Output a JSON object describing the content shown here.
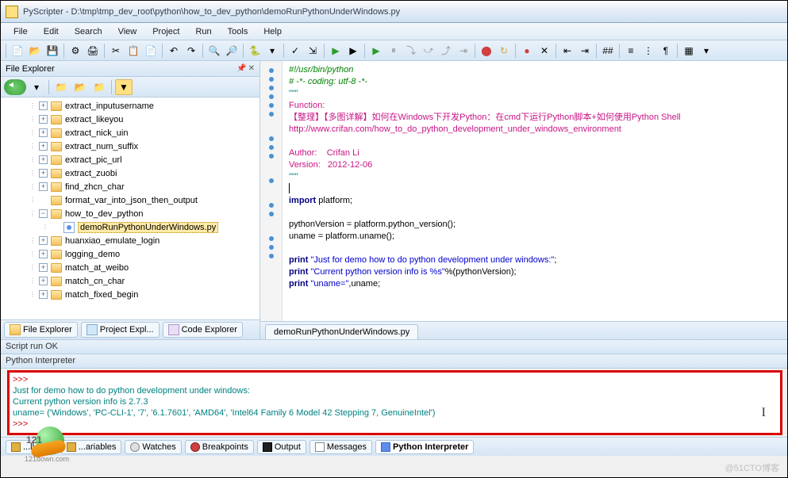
{
  "window": {
    "title": "PyScripter - D:\\tmp\\tmp_dev_root\\python\\how_to_dev_python\\demoRunPythonUnderWindows.py"
  },
  "menu": [
    "File",
    "Edit",
    "Search",
    "View",
    "Project",
    "Run",
    "Tools",
    "Help"
  ],
  "sidebar": {
    "title": "File Explorer",
    "items": [
      {
        "label": "extract_inputusername",
        "exp": "+",
        "level": 2
      },
      {
        "label": "extract_likeyou",
        "exp": "+",
        "level": 2
      },
      {
        "label": "extract_nick_uin",
        "exp": "+",
        "level": 2
      },
      {
        "label": "extract_num_suffix",
        "exp": "+",
        "level": 2
      },
      {
        "label": "extract_pic_url",
        "exp": "+",
        "level": 2
      },
      {
        "label": "extract_zuobi",
        "exp": "+",
        "level": 2
      },
      {
        "label": "find_zhcn_char",
        "exp": "+",
        "level": 2
      },
      {
        "label": "format_var_into_json_then_output",
        "exp": "",
        "level": 2
      },
      {
        "label": "how_to_dev_python",
        "exp": "−",
        "level": 2
      },
      {
        "label": "demoRunPythonUnderWindows.py",
        "exp": "",
        "level": 3,
        "file": true,
        "selected": true
      },
      {
        "label": "huanxiao_emulate_login",
        "exp": "+",
        "level": 2
      },
      {
        "label": "logging_demo",
        "exp": "+",
        "level": 2
      },
      {
        "label": "match_at_weibo",
        "exp": "+",
        "level": 2
      },
      {
        "label": "match_cn_char",
        "exp": "+",
        "level": 2
      },
      {
        "label": "match_fixed_begin",
        "exp": "+",
        "level": 2
      }
    ],
    "tabs": [
      "File Explorer",
      "Project Expl...",
      "Code Explorer"
    ]
  },
  "editor": {
    "tab": "demoRunPythonUnderWindows.py",
    "code": {
      "l1": "#!/usr/bin/python",
      "l2": "# -*- coding: utf-8 -*-",
      "l3": "\"\"\"",
      "l4": "Function:",
      "l5": "【整理】【多图详解】如何在Windows下开发Python：在cmd下运行Python脚本+如何使用Python Shell",
      "l6": "http://www.crifan.com/how_to_do_python_development_under_windows_environment",
      "l7": "",
      "l8": "Author:    Crifan Li",
      "l9": "Version:   2012-12-06",
      "l10": "\"\"\"",
      "l11": "",
      "l12": "import",
      "l12b": " platform;",
      "l13": "",
      "l14": "pythonVersion = platform.python_version();",
      "l15": "uname = platform.uname();",
      "l16": "",
      "l17a": "print",
      "l17b": " \"Just for demo how to do python development under windows:\"",
      "l17c": ";",
      "l18a": "print",
      "l18b": " \"Current python version info is %s\"",
      "l18c": "%(pythonVersion);",
      "l19a": "print",
      "l19b": " \"uname=\"",
      "l19c": ",uname;"
    }
  },
  "status": {
    "run": "Script run OK",
    "interp": "Python Interpreter"
  },
  "output": {
    "prompt1": ">>>",
    "line1": "Just for demo how to do python development under windows:",
    "line2": "Current python version info is 2.7.3",
    "line3": "uname= ('Windows', 'PC-CLI-1', '7', '6.1.7601', 'AMD64', 'Intel64 Family 6 Model 42 Stepping 7, GenuineIntel')",
    "prompt2": ">>>"
  },
  "bottom_tabs": [
    {
      "label": "...ll St...",
      "icon": "var"
    },
    {
      "label": "...ariables",
      "icon": "var"
    },
    {
      "label": "Watches",
      "icon": "watch"
    },
    {
      "label": "Breakpoints",
      "icon": "bp"
    },
    {
      "label": "Output",
      "icon": "out"
    },
    {
      "label": "Messages",
      "icon": "msg"
    },
    {
      "label": "Python Interpreter",
      "icon": "py",
      "active": true
    }
  ],
  "watermark": "@51CTO博客",
  "logo": {
    "main": "121",
    "sub": "121down.com"
  }
}
